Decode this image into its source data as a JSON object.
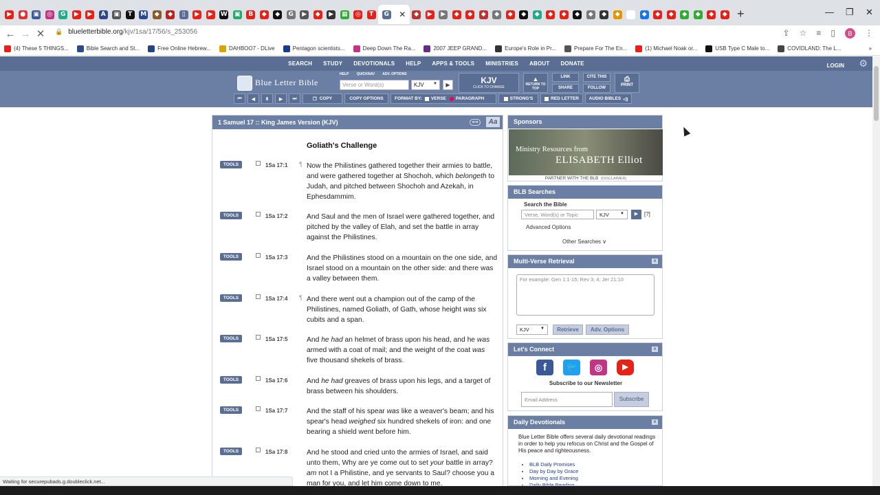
{
  "browser": {
    "active_tab_close": "✕",
    "new_tab": "+",
    "url_host": "blueletterbible.org",
    "url_path": "/kjv/1sa/17/56/s_253056",
    "avatar": "B",
    "bookmarks": [
      {
        "label": "(4) These 5 THINGS...",
        "color": "#e62117"
      },
      {
        "label": "Bible Search and St...",
        "color": "#2c4a8a"
      },
      {
        "label": "Free Online Hebrew...",
        "color": "#224488"
      },
      {
        "label": "DAHBOO7 - DLive",
        "color": "#d6a500"
      },
      {
        "label": "Pentagon scientists...",
        "color": "#1a3a8a"
      },
      {
        "label": "Deep Down The Ra...",
        "color": "#c13584"
      },
      {
        "label": "2007 JEEP GRAND...",
        "color": "#6a2a8a"
      },
      {
        "label": "Europe's Role in Pr...",
        "color": "#333333"
      },
      {
        "label": "Prepare For The En...",
        "color": "#555555"
      },
      {
        "label": "(1) Michael Noak or...",
        "color": "#e62117"
      },
      {
        "label": "USB Type C Male to...",
        "color": "#111111"
      },
      {
        "label": "COVIDLAND: The L...",
        "color": "#444444"
      }
    ]
  },
  "nav": {
    "items": [
      "SEARCH",
      "STUDY",
      "DEVOTIONALS",
      "HELP",
      "APPS & TOOLS",
      "MINISTRIES",
      "ABOUT",
      "DONATE"
    ],
    "login": "LOGIN"
  },
  "header": {
    "logo": "Blue Letter Bible",
    "small_links": [
      "HELP",
      "QUICKNAV",
      "ADV. OPTIONS"
    ],
    "search_placeholder": "Verse or Word(s)",
    "version": "KJV",
    "kjv_big": "KJV",
    "kjv_small": "CLICK TO CHANGE",
    "return_to_top": "RETURN TO TOP",
    "link": "LINK",
    "share": "SHARE",
    "cite": "CITE THIS",
    "follow": "FOLLOW",
    "print": "PRINT",
    "copy": "COPY",
    "copy_options": "COPY OPTIONS",
    "format_by": "FORMAT BY:",
    "verse": "VERSE",
    "paragraph": "PARAGRAPH",
    "strongs": "STRONG'S",
    "red_letter": "RED LETTER",
    "audio": "AUDIO BIBLES"
  },
  "bible": {
    "title": "1 Samuel 17 :: King James Version (KJV)",
    "aa": "Aa",
    "heading": "Goliath's Challenge",
    "tools_label": "TOOLS",
    "verses": [
      {
        "ref": "1Sa 17:1",
        "pilcrow": "¶",
        "text": "Now the Philistines gathered together their armies to battle, and were gathered together at Shochoh, which belongeth to Judah, and pitched between Shochoh and Azekah, in Ephesdammim."
      },
      {
        "ref": "1Sa 17:2",
        "pilcrow": "",
        "text": "And Saul and the men of Israel were gathered together, and pitched by the valley of Elah, and set the battle in array against the Philistines."
      },
      {
        "ref": "1Sa 17:3",
        "pilcrow": "",
        "text": "And the Philistines stood on a mountain on the one side, and Israel stood on a mountain on the other side: and there was a valley between them."
      },
      {
        "ref": "1Sa 17:4",
        "pilcrow": "¶",
        "text": "And there went out a champion out of the camp of the Philistines, named Goliath, of Gath, whose height was six cubits and a span."
      },
      {
        "ref": "1Sa 17:5",
        "pilcrow": "",
        "text": "And he had an helmet of brass upon his head, and he was armed with a coat of mail; and the weight of the coat was five thousand shekels of brass."
      },
      {
        "ref": "1Sa 17:6",
        "pilcrow": "",
        "text": "And he had greaves of brass upon his legs, and a target of brass between his shoulders."
      },
      {
        "ref": "1Sa 17:7",
        "pilcrow": "",
        "text": "And the staff of his spear was like a weaver's beam; and his spear's head weighed six hundred shekels of iron: and one bearing a shield went before him."
      },
      {
        "ref": "1Sa 17:8",
        "pilcrow": "",
        "text": "And he stood and cried unto the armies of Israel, and said unto them, Why are ye come out to set your battle in array? am not I a Philistine, and ye servants to Saul? choose you a man for you, and let him come down to me."
      }
    ]
  },
  "sidebar": {
    "sponsors": "Sponsors",
    "banner_l1": "Ministry Resources from",
    "banner_l2": "ELISABETH Elliot",
    "partner": "PARTNER WITH THE BLB",
    "disclaimer": "(DISCLAIMER)",
    "searches": "BLB Searches",
    "search_bible": "Search the Bible",
    "search_placeholder": "Verse, Word(s) or Topic",
    "version": "KJV",
    "help": "[?]",
    "advanced": "Advanced Options",
    "other": "Other Searches ∨",
    "multi": "Multi-Verse Retrieval",
    "multi_placeholder": "For example: Gen 1:1-15; Rev 3; 4; Jer 21:10",
    "retrieve": "Retrieve",
    "adv_options": "Adv. Options",
    "connect": "Let's Connect",
    "subscribe_text": "Subscribe to our Newsletter",
    "email_placeholder": "Email Address",
    "subscribe": "Subscribe",
    "devotionals": "Daily Devotionals",
    "dev_text": "Blue Letter Bible offers several daily devotional readings in order to help you refocus on Christ and the Gospel of His peace and righteousness.",
    "dev_list": [
      "BLB Daily Promises",
      "Day by Day by Grace",
      "Morning and Evening",
      "Daily Bible Reading"
    ]
  },
  "status": "Waiting for securepubads.g.doubleclick.net..."
}
